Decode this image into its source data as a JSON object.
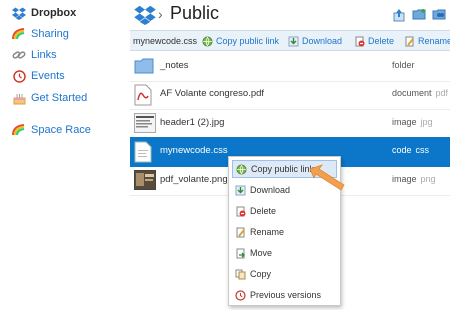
{
  "sidebar": {
    "brand": "Dropbox",
    "items": [
      {
        "label": "Sharing",
        "icon": "rainbow-icon"
      },
      {
        "label": "Links",
        "icon": "chain-link-icon"
      },
      {
        "label": "Events",
        "icon": "clock-icon"
      },
      {
        "label": "Get Started",
        "icon": "cake-icon"
      },
      {
        "label": "Space Race",
        "icon": "rainbow-icon"
      }
    ]
  },
  "header": {
    "title": "Public",
    "icons": [
      "upload-icon",
      "new-folder-icon",
      "share-folder-icon"
    ]
  },
  "toolbar": {
    "selected_file": "mynewcode.css",
    "actions": [
      {
        "label": "Copy public link",
        "icon": "globe-link-icon"
      },
      {
        "label": "Download",
        "icon": "download-icon"
      },
      {
        "label": "Delete",
        "icon": "delete-icon"
      },
      {
        "label": "Rename",
        "icon": "rename-icon"
      }
    ]
  },
  "files": [
    {
      "name": "_notes",
      "kind": "folder",
      "ext": "",
      "icon": "folder-icon"
    },
    {
      "name": "AF Volante congreso.pdf",
      "kind": "document",
      "ext": "pdf",
      "icon": "pdf-icon"
    },
    {
      "name": "header1 (2).jpg",
      "kind": "image",
      "ext": "jpg",
      "icon": "image-thumbnail-icon"
    },
    {
      "name": "mynewcode.css",
      "kind": "code",
      "ext": "css",
      "icon": "css-file-icon",
      "selected": true
    },
    {
      "name": "pdf_volante.png",
      "kind": "image",
      "ext": "png",
      "icon": "image-thumbnail-icon"
    }
  ],
  "context_menu": {
    "items": [
      {
        "label": "Copy public link",
        "icon": "globe-link-icon",
        "highlighted": true
      },
      {
        "label": "Download",
        "icon": "download-icon"
      },
      {
        "label": "Delete",
        "icon": "delete-icon"
      },
      {
        "label": "Rename",
        "icon": "rename-icon"
      },
      {
        "label": "Move",
        "icon": "move-icon"
      },
      {
        "label": "Copy",
        "icon": "copy-icon"
      },
      {
        "label": "Previous versions",
        "icon": "previous-versions-icon"
      }
    ]
  },
  "colors": {
    "accent": "#1f75cc",
    "selected_row": "#0c76c8",
    "toolbar_bg": "#e9f1f9",
    "arrow": "#f0a050"
  }
}
